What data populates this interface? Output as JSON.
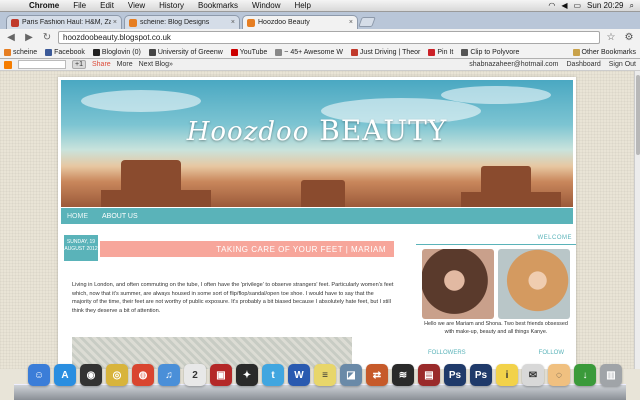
{
  "menubar": {
    "app_name": "Chrome",
    "items": [
      "File",
      "Edit",
      "View",
      "History",
      "Bookmarks",
      "Window",
      "Help"
    ],
    "clock": "Sun 20:29"
  },
  "tabs": [
    {
      "title": "Paris Fashion Haul: H&M, Za",
      "color": "#c0392b"
    },
    {
      "title": "scheine: Blog Designs",
      "color": "#e67e22"
    },
    {
      "title": "Hoozdoo Beauty",
      "color": "#e67e22",
      "active": true
    }
  ],
  "toolbar": {
    "url": "hoozdoobeauty.blogspot.co.uk"
  },
  "bookmarks": [
    {
      "label": "scheine",
      "color": "#e67e22"
    },
    {
      "label": "Facebook",
      "color": "#3b5998"
    },
    {
      "label": "Bloglovin (0)",
      "color": "#222222"
    },
    {
      "label": "University of Greenw",
      "color": "#444444"
    },
    {
      "label": "YouTube",
      "color": "#cc0000"
    },
    {
      "label": "~ 45+ Awesome W",
      "color": "#888888"
    },
    {
      "label": "Just Driving | Theor",
      "color": "#c0392b"
    },
    {
      "label": "Pin It",
      "color": "#cb2027"
    },
    {
      "label": "Clip to Polyvore",
      "color": "#555555"
    },
    {
      "label": "Other Bookmarks",
      "color": "#c9a24a"
    }
  ],
  "bloggerbar": {
    "gplus": "+1",
    "share": "Share",
    "more": "More",
    "next": "Next Blog»",
    "email": "shabnazaheer@hotmail.com",
    "dashboard": "Dashboard",
    "signout": "Sign Out"
  },
  "blog": {
    "title_script": "Hoozdoo",
    "title_caps": "BEAUTY",
    "nav": [
      "HOME",
      "ABOUT US"
    ],
    "post": {
      "date_line1": "SUNDAY, 19",
      "date_line2": "AUGUST 2012",
      "title": "TAKING CARE OF YOUR FEET | MARIAM",
      "body": "Living in London, and often commuting on the tube, I often have the 'privilege' to observe strangers' feet. Particularly women's feet which, now that it's summer, are always housed in some sort of flip/flop/sandal/open toe shoe. I would have to say that the majority of the time, their feet are not worthy of public exposure. It's probably a bit biased because I absolutely hate feet, but I still think they deserve a bit of attention."
    },
    "sidebar": {
      "welcome_title": "WELCOME",
      "welcome_text": "Hello we are Mariam and Shona. Two best friends obsessed with make-up, beauty and all things Kanye.",
      "followers": "FOLLOWERS",
      "follow": "FOLLOW"
    }
  },
  "dock": [
    {
      "name": "finder",
      "color": "#3b7dd8",
      "glyph": "☺"
    },
    {
      "name": "app-store",
      "color": "#2a8ee0",
      "glyph": "A"
    },
    {
      "name": "dashboard",
      "color": "#333333",
      "glyph": "◉"
    },
    {
      "name": "notes",
      "color": "#d8b43c",
      "glyph": "◎"
    },
    {
      "name": "chrome",
      "color": "#d9452f",
      "glyph": "◍"
    },
    {
      "name": "itunes",
      "color": "#4a8fd8",
      "glyph": "♫"
    },
    {
      "name": "calendar",
      "color": "#e8e8e8",
      "glyph": "2"
    },
    {
      "name": "photo-booth",
      "color": "#b42828",
      "glyph": "▣"
    },
    {
      "name": "tweetdeck",
      "color": "#2a2a2a",
      "glyph": "✦"
    },
    {
      "name": "twitter",
      "color": "#41a6e0",
      "glyph": "t"
    },
    {
      "name": "word",
      "color": "#2a5ab0",
      "glyph": "W"
    },
    {
      "name": "stickies",
      "color": "#e8d66a",
      "glyph": "≡"
    },
    {
      "name": "preview",
      "color": "#6a8aa8",
      "glyph": "◪"
    },
    {
      "name": "transmit",
      "color": "#c65a2a",
      "glyph": "⇄"
    },
    {
      "name": "spotify",
      "color": "#2a2a2a",
      "glyph": "≋"
    },
    {
      "name": "archive",
      "color": "#9a2a2a",
      "glyph": "▤"
    },
    {
      "name": "photoshop",
      "color": "#1f3a6a",
      "glyph": "Ps"
    },
    {
      "name": "photoshop-2",
      "color": "#1f3a6a",
      "glyph": "Ps"
    },
    {
      "name": "idea",
      "color": "#f2d24a",
      "glyph": "i"
    },
    {
      "name": "mail",
      "color": "#d8d8d8",
      "glyph": "✉"
    },
    {
      "name": "cake",
      "color": "#f0c080",
      "glyph": "◌"
    },
    {
      "name": "downloads",
      "color": "#3a9a3a",
      "glyph": "↓"
    },
    {
      "name": "trash",
      "color": "#a0a4a8",
      "glyph": "▥"
    }
  ]
}
